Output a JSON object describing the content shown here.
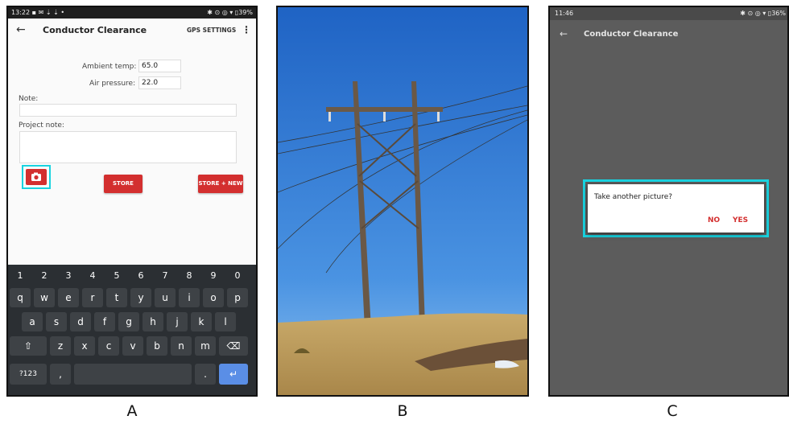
{
  "panel_a": {
    "status_time": "13:22",
    "status_icons_left": "▪ ✉ ⇣ ⇣ •",
    "status_right": "✱ ⊙ ◎ ▾ ▯39%",
    "title": "Conductor Clearance",
    "gps_settings_label": "GPS SETTINGS",
    "menu_glyph": "⋮",
    "back_glyph": "←",
    "ambient_temp_label": "Ambient temp:",
    "ambient_temp_value": "65.0",
    "air_pressure_label": "Air pressure:",
    "air_pressure_value": "22.0",
    "note_label": "Note:",
    "project_note_label": "Project note:",
    "store_label": "STORE",
    "store_new_label": "STORE + NEW",
    "keyboard": {
      "numbers": [
        "1",
        "2",
        "3",
        "4",
        "5",
        "6",
        "7",
        "8",
        "9",
        "0"
      ],
      "row1": [
        "q",
        "w",
        "e",
        "r",
        "t",
        "y",
        "u",
        "i",
        "o",
        "p"
      ],
      "row2": [
        "a",
        "s",
        "d",
        "f",
        "g",
        "h",
        "j",
        "k",
        "l"
      ],
      "row3": [
        "z",
        "x",
        "c",
        "v",
        "b",
        "n",
        "m"
      ],
      "shift_glyph": "⇧",
      "delete_glyph": "⌫",
      "symbols_label": "?123",
      "comma": ",",
      "period": ".",
      "enter_glyph": "↵"
    }
  },
  "panel_c": {
    "status_time": "11:46",
    "status_right": "✱ ⊙ ◎ ▾ ▯36%",
    "back_glyph": "←",
    "title": "Conductor Clearance",
    "dialog_message": "Take another picture?",
    "no_label": "NO",
    "yes_label": "YES"
  },
  "captions": {
    "a": "A",
    "b": "B",
    "c": "C"
  },
  "colors": {
    "accent_red": "#d32f2f",
    "highlight_cyan": "#19d3e0",
    "sky_blue": "#2d78d6",
    "keyboard_bg": "#2b2f33",
    "dimmed_bg": "#5c5c5c"
  },
  "icons": [
    "back-arrow-icon",
    "overflow-menu-icon",
    "camera-icon",
    "shift-icon",
    "backspace-icon",
    "enter-icon"
  ]
}
